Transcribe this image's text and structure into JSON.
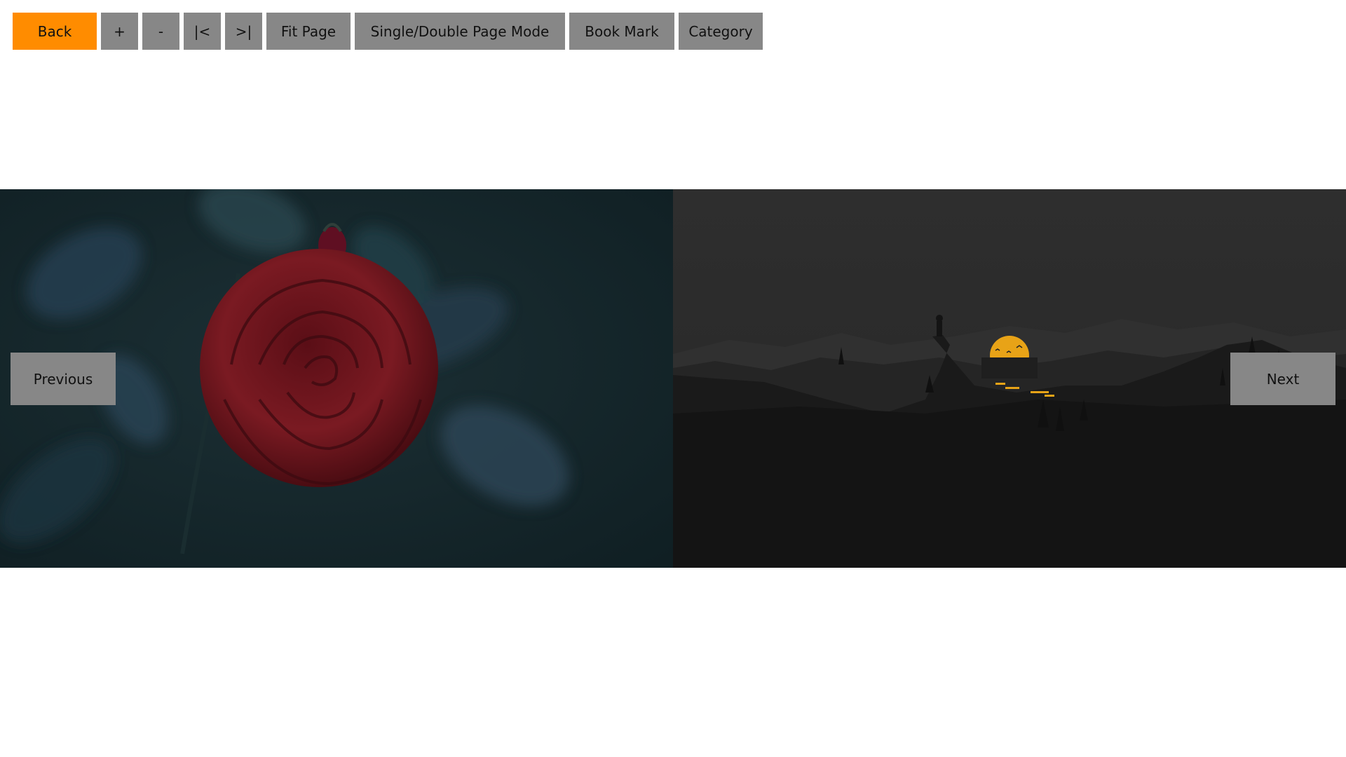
{
  "toolbar": {
    "back": "Back",
    "zoom_in": "+",
    "zoom_out": "-",
    "first_page": "|<",
    "last_page": ">|",
    "fit_page": "Fit Page",
    "page_mode": "Single/Double Page Mode",
    "bookmark": "Book Mark",
    "category": "Category"
  },
  "navigation": {
    "previous": "Previous",
    "next": "Next"
  },
  "colors": {
    "accent": "#ff8c00",
    "button": "#878787",
    "left_page_bg": "#132428",
    "right_page_bg": "#2b2b2b"
  }
}
